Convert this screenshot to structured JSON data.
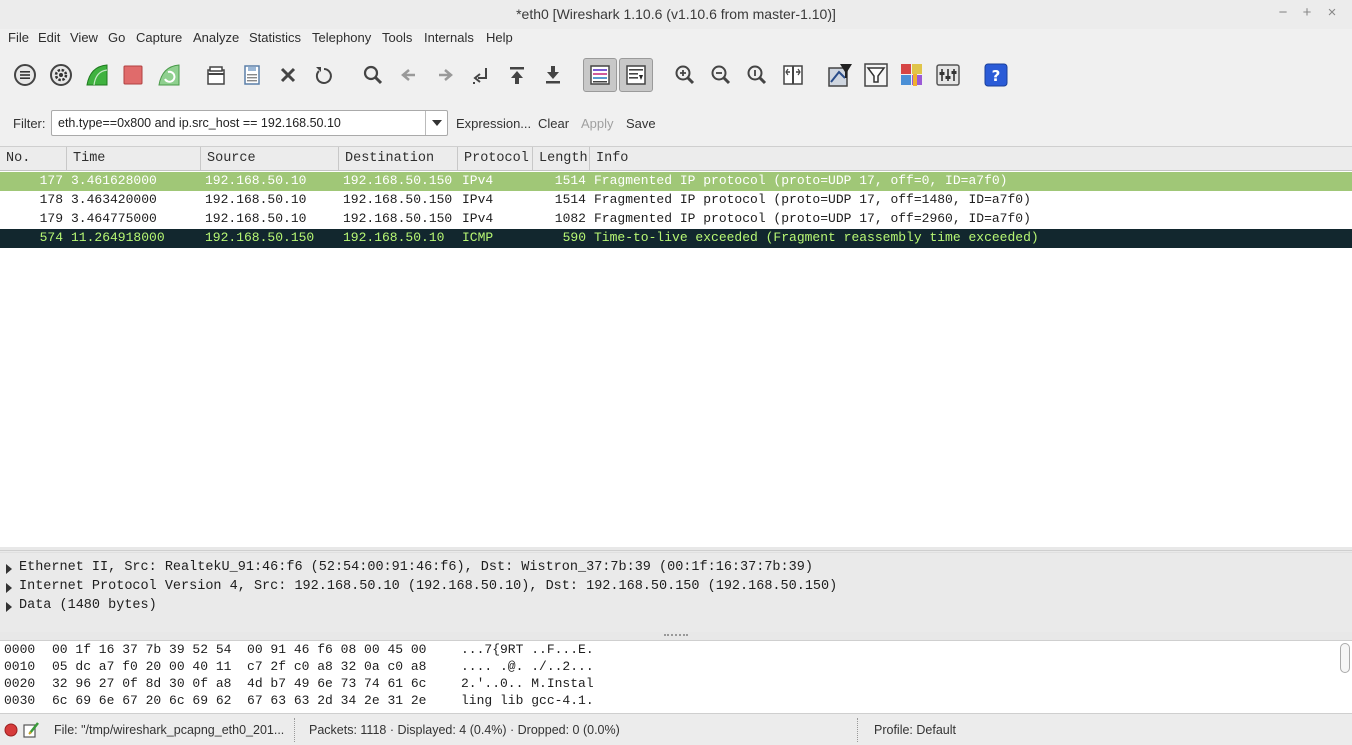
{
  "window": {
    "title": "*eth0  [Wireshark 1.10.6  (v1.10.6 from master-1.10)]",
    "minimize": "−",
    "maximize": "+",
    "close": "×"
  },
  "menu": [
    "File",
    "Edit",
    "View",
    "Go",
    "Capture",
    "Analyze",
    "Statistics",
    "Telephony",
    "Tools",
    "Internals",
    "Help"
  ],
  "filter": {
    "label": "Filter:",
    "value": "eth.type==0x800 and ip.src_host == 192.168.50.10",
    "expression": "Expression...",
    "clear": "Clear",
    "apply": "Apply",
    "save": "Save"
  },
  "packet_list": {
    "columns": [
      "No.",
      "Time",
      "Source",
      "Destination",
      "Protocol",
      "Length",
      "Info"
    ],
    "rows": [
      {
        "no": "177",
        "time": "3.461628000",
        "src": "192.168.50.10",
        "dst": "192.168.50.150",
        "proto": "IPv4",
        "len": "1514",
        "info": "Fragmented IP protocol (proto=UDP 17, off=0, ID=a7f0)",
        "bg": "#a0c777",
        "fg": "#ffffff"
      },
      {
        "no": "178",
        "time": "3.463420000",
        "src": "192.168.50.10",
        "dst": "192.168.50.150",
        "proto": "IPv4",
        "len": "1514",
        "info": "Fragmented IP protocol (proto=UDP 17, off=1480, ID=a7f0)",
        "bg": "#ffffff",
        "fg": "#1e1e1e"
      },
      {
        "no": "179",
        "time": "3.464775000",
        "src": "192.168.50.10",
        "dst": "192.168.50.150",
        "proto": "IPv4",
        "len": "1082",
        "info": "Fragmented IP protocol (proto=UDP 17, off=2960, ID=a7f0)",
        "bg": "#ffffff",
        "fg": "#1e1e1e"
      },
      {
        "no": "574",
        "time": "11.264918000",
        "src": "192.168.50.150",
        "dst": "192.168.50.10",
        "proto": "ICMP",
        "len": "590",
        "info": "Time-to-live exceeded (Fragment reassembly time exceeded)",
        "bg": "#12272e",
        "fg": "#b7f774"
      }
    ]
  },
  "details": {
    "rows": [
      "Ethernet II, Src: RealtekU_91:46:f6 (52:54:00:91:46:f6), Dst: Wistron_37:7b:39 (00:1f:16:37:7b:39)",
      "Internet Protocol Version 4, Src: 192.168.50.10 (192.168.50.10), Dst: 192.168.50.150 (192.168.50.150)",
      "Data (1480 bytes)"
    ]
  },
  "hex": {
    "rows": [
      {
        "offset": "0000",
        "bytes": "00 1f 16 37 7b 39 52 54  00 91 46 f6 08 00 45 00",
        "ascii": "...7{9RT ..F...E."
      },
      {
        "offset": "0010",
        "bytes": "05 dc a7 f0 20 00 40 11  c7 2f c0 a8 32 0a c0 a8",
        "ascii": ".... .@. ./..2..."
      },
      {
        "offset": "0020",
        "bytes": "32 96 27 0f 8d 30 0f a8  4d b7 49 6e 73 74 61 6c",
        "ascii": "2.'..0.. M.Instal"
      },
      {
        "offset": "0030",
        "bytes": "6c 69 6e 67 20 6c 69 62  67 63 63 2d 34 2e 31 2e",
        "ascii": "ling lib gcc-4.1."
      }
    ]
  },
  "status": {
    "file": "File: \"/tmp/wireshark_pcapng_eth0_201...",
    "packets": "Packets: 1118 · Displayed: 4 (0.4%) · Dropped: 0 (0.0%)",
    "profile": "Profile: Default"
  },
  "toolbar_icons": [
    "interface-list-icon",
    "capture-options-icon",
    "start-capture-icon",
    "stop-capture-icon",
    "restart-capture-icon",
    "open-file-icon",
    "save-file-icon",
    "close-file-icon",
    "reload-file-icon",
    "find-packet-icon",
    "go-back-icon",
    "go-forward-icon",
    "go-to-packet-icon",
    "first-packet-icon",
    "last-packet-icon",
    "colorize-icon",
    "auto-scroll-icon",
    "zoom-in-icon",
    "zoom-out-icon",
    "normal-size-icon",
    "resize-columns-icon",
    "capture-filters-icon",
    "display-filters-icon",
    "coloring-rules-icon",
    "preferences-icon",
    "help-icon"
  ],
  "colors": {
    "selected_green": "#a0c777",
    "icmp_row_bg": "#12272e",
    "icmp_row_fg": "#b7f774",
    "help_blue": "#2a5bd7",
    "status_red": "#d63b3b"
  }
}
